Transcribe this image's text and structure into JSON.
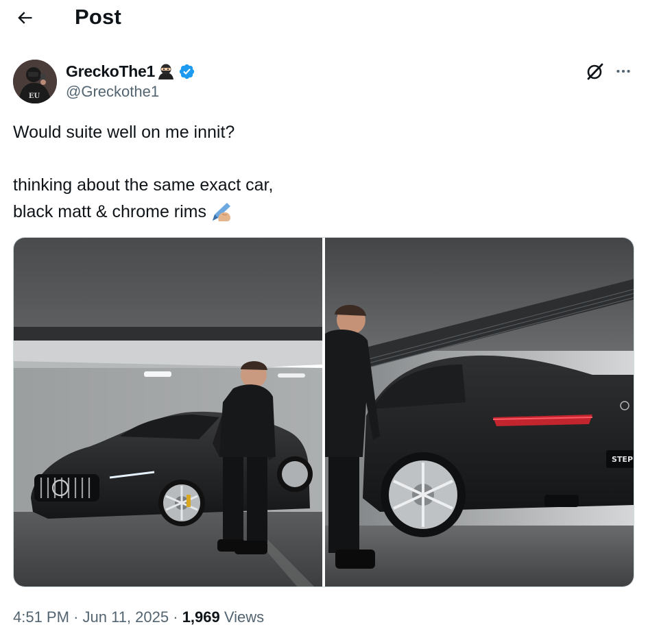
{
  "header": {
    "title": "Post",
    "back_icon": "arrow-left-icon"
  },
  "author": {
    "name": "GreckoThe1",
    "handle": "@Greckothe1",
    "verified": true,
    "verified_color": "#1d9bf0",
    "name_emoji": "ninja"
  },
  "actions": {
    "grok_icon": "grok-icon",
    "more_icon": "more-horizontal-icon"
  },
  "tweet": {
    "line1": "Would suite well on me innit?",
    "line2": "thinking about the same exact car,",
    "line3": "black matt & chrome rims",
    "trailing_emoji": "writing-hand"
  },
  "media": {
    "photo_count": 2,
    "photos": [
      {
        "name": "Front view of matte black Mercedes-AMG GT with man standing beside it"
      },
      {
        "name": "Rear view of matte black Mercedes-AMG GT with chrome rims and man standing beside it"
      }
    ]
  },
  "meta": {
    "time": "4:51 PM",
    "separator": "·",
    "date": "Jun 11, 2025",
    "views_count": "1,969",
    "views_label": "Views"
  }
}
